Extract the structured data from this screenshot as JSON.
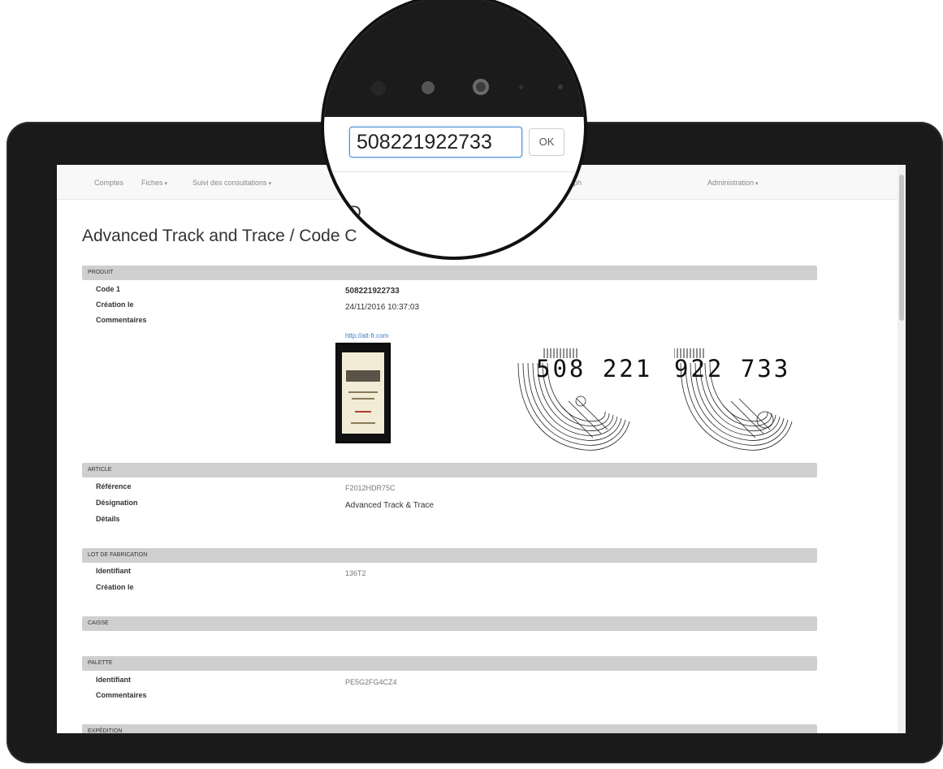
{
  "navbar": {
    "items": [
      "Comptes",
      "Fiches",
      "Suivi des consultations",
      "ph",
      "Administration"
    ]
  },
  "page": {
    "title": "Advanced Track and Trace / Code C"
  },
  "search": {
    "value": "508221922733",
    "ok_label": "OK"
  },
  "sections": {
    "produit": "Produit",
    "article": "Article",
    "lot": "Lot de fabrication",
    "caisse": "Caisse",
    "palette": "Palette",
    "expedition": "Expédition"
  },
  "produit": {
    "code_label": "Code 1",
    "code_value": "508221922733",
    "creation_label": "Création le",
    "creation_value": "24/11/2016 10:37:03",
    "comments_label": "Commentaires",
    "link": "http://att-fr.com",
    "code_digits_1": "508 221",
    "code_digits_2": "922 733"
  },
  "article": {
    "reference_label": "Référence",
    "reference_value": "F2012HDR75C",
    "designation_label": "Désignation",
    "designation_value": "Advanced Track & Trace",
    "details_label": "Détails"
  },
  "lot": {
    "identifiant_label": "Identifiant",
    "identifiant_value": "136T2",
    "creation_label": "Création le"
  },
  "palette": {
    "identifiant_label": "Identifiant",
    "identifiant_value": "PE5G2FG4CZ4",
    "comments_label": "Commentaires"
  }
}
